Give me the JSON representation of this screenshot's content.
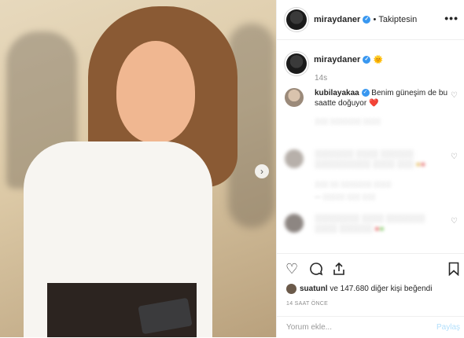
{
  "header": {
    "username": "miraydaner",
    "separator": "•",
    "follow_status": "Takiptesin",
    "more": "•••"
  },
  "caption": {
    "username": "miraydaner",
    "emoji": "🌞",
    "time": "14s"
  },
  "comments": [
    {
      "username": "kubilayakaa",
      "text": "Benim güneşim de bu saatte doğuyor",
      "emoji": "❤️",
      "blurred": false
    },
    {
      "username": "",
      "text": "",
      "meta": "",
      "blurred": true
    },
    {
      "username": "",
      "text": "",
      "meta": "",
      "blurred": true
    },
    {
      "username": "",
      "text": "",
      "meta": "",
      "blurred": true
    }
  ],
  "actions": {
    "likes_user": "suatunl",
    "likes_rest": "ve 147.680 diğer kişi beğendi",
    "ago": "14 SAAT ÖNCE"
  },
  "composer": {
    "placeholder": "Yorum ekle...",
    "share": "Paylaş"
  },
  "colors": {
    "verified": "#3897f0",
    "share_disabled": "#b2dffc",
    "heart": "#ed4956"
  },
  "icons": [
    "heart-icon",
    "comment-icon",
    "share-icon",
    "bookmark-icon",
    "chevron-right-icon",
    "more-icon",
    "verified-icon"
  ]
}
